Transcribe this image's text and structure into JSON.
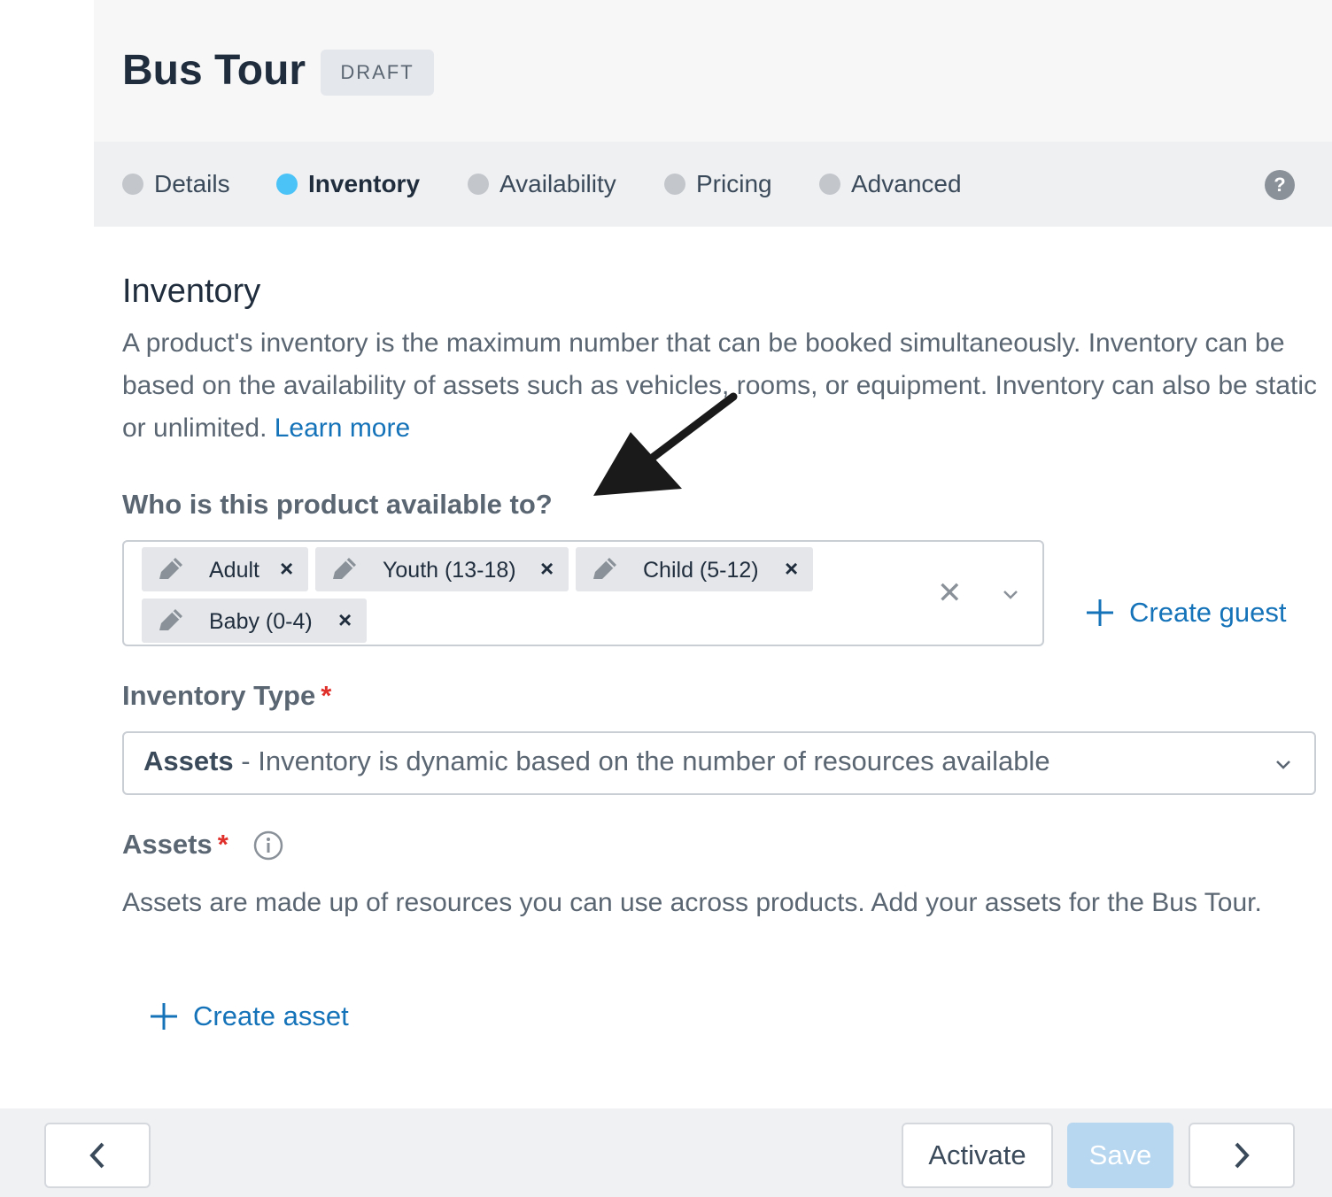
{
  "header": {
    "title": "Bus Tour",
    "status_badge": "DRAFT"
  },
  "tabs": [
    {
      "label": "Details",
      "active": false
    },
    {
      "label": "Inventory",
      "active": true
    },
    {
      "label": "Availability",
      "active": false
    },
    {
      "label": "Pricing",
      "active": false
    },
    {
      "label": "Advanced",
      "active": false
    }
  ],
  "help_glyph": "?",
  "inventory": {
    "title": "Inventory",
    "description": "A product's inventory is the maximum number that can be booked simultaneously. Inventory can be based on the availability of assets such as vehicles, rooms, or equipment. Inventory can also be static or unlimited.",
    "learn_more": "Learn more"
  },
  "guests": {
    "label": "Who is this product available to?",
    "chips": [
      "Adult",
      "Youth (13-18)",
      "Child (5-12)",
      "Baby (0-4)"
    ],
    "remove_glyph": "×",
    "clear_glyph": "✕",
    "create_label": "Create guest"
  },
  "inventory_type": {
    "label": "Inventory Type",
    "required_mark": "*",
    "selected_bold": "Assets",
    "selected_rest": " - Inventory is dynamic based on the number of resources available"
  },
  "assets": {
    "label": "Assets",
    "required_mark": "*",
    "description": "Assets are made up of resources you can use across products. Add your assets for the Bus Tour.",
    "create_label": "Create asset"
  },
  "footer": {
    "prev_glyph": "‹",
    "activate_label": "Activate",
    "save_label": "Save",
    "next_glyph": "›"
  },
  "colors": {
    "accent": "#1573b9",
    "active_tab_dot": "#4cc3f7",
    "required": "#e0302b",
    "save_disabled": "#b7d6ef"
  },
  "icons": [
    "pencil-icon",
    "close-icon",
    "chevron-down-icon",
    "plus-icon",
    "info-icon",
    "help-icon",
    "chevron-left-icon",
    "chevron-right-icon",
    "annotation-arrow"
  ]
}
